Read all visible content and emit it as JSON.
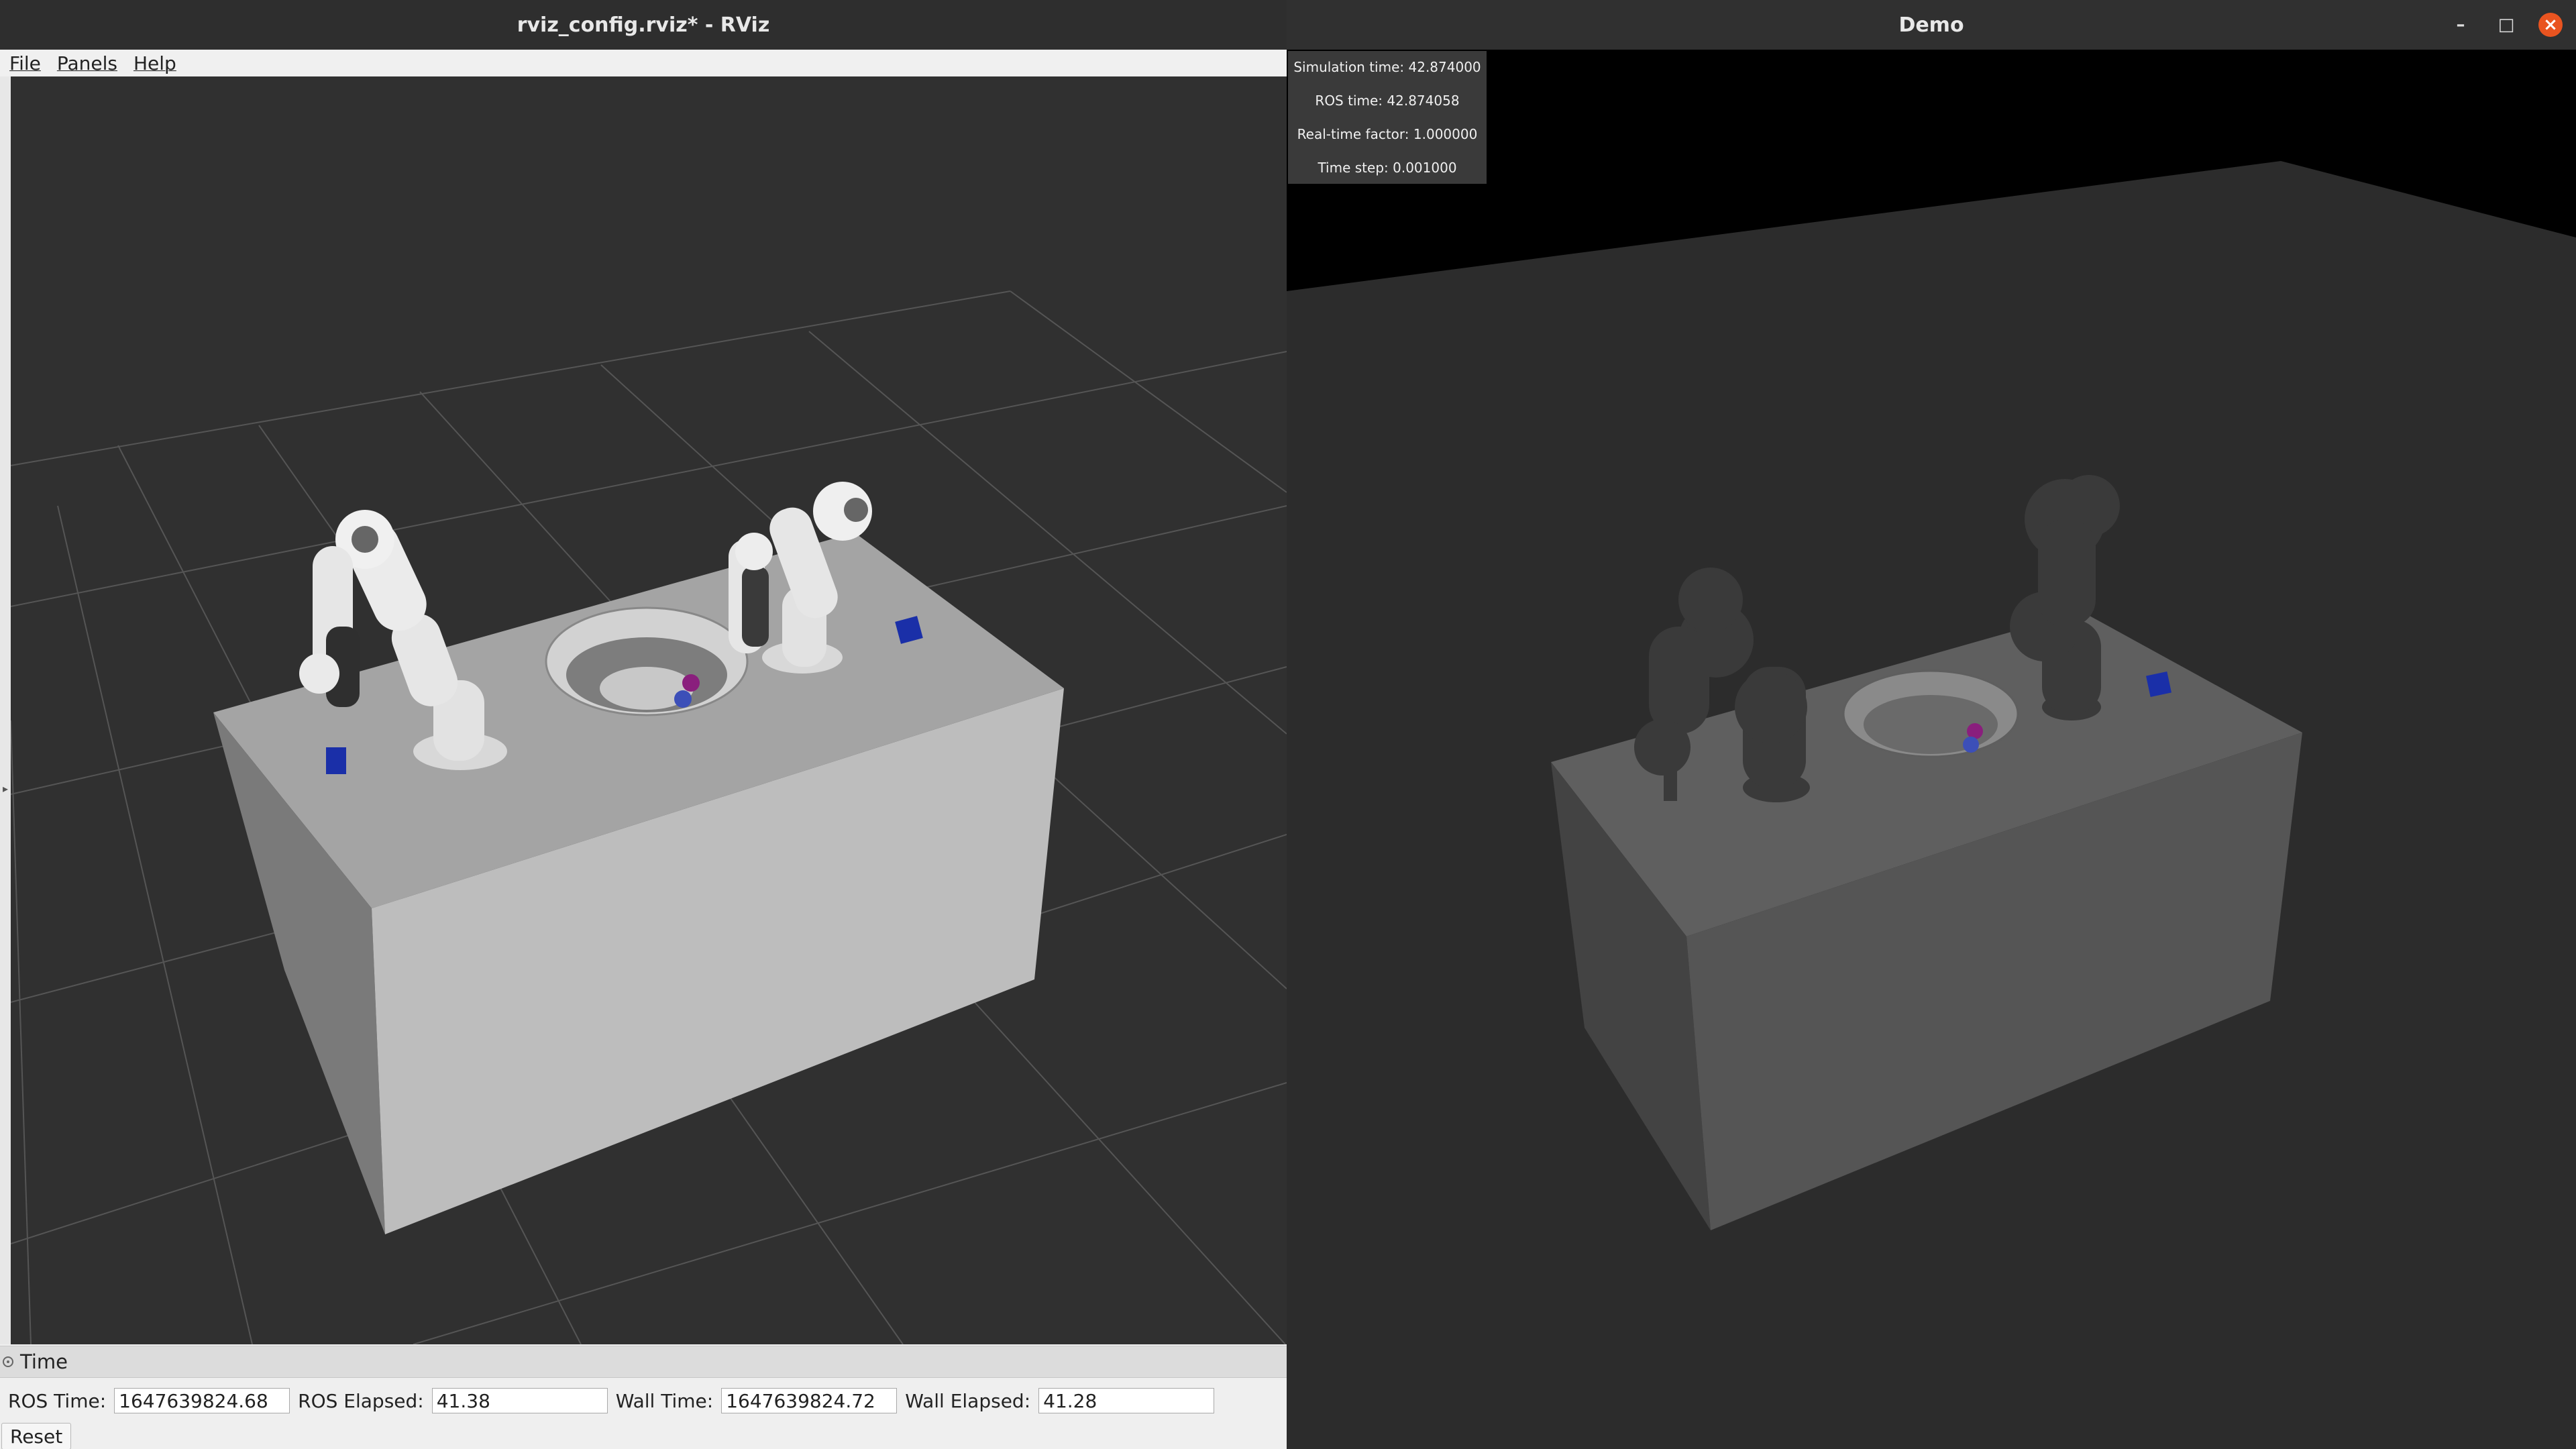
{
  "rviz": {
    "title": "rviz_config.rviz* - RViz",
    "menu": [
      "File",
      "Panels",
      "Help"
    ],
    "time_panel": {
      "title": "Time",
      "ros_time_label": "ROS Time:",
      "ros_time_value": "1647639824.68",
      "ros_elapsed_label": "ROS Elapsed:",
      "ros_elapsed_value": "41.38",
      "wall_time_label": "Wall Time:",
      "wall_time_value": "1647639824.72",
      "wall_elapsed_label": "Wall Elapsed:",
      "wall_elapsed_value": "41.28",
      "reset_label": "Reset"
    }
  },
  "demo": {
    "title": "Demo",
    "stats": {
      "simulation_time": "Simulation time: 42.874000",
      "ros_time": "ROS time: 42.874058",
      "real_time_factor": "Real-time factor: 1.000000",
      "time_step": "Time step: 0.001000"
    }
  },
  "colors": {
    "titlebar": "#2e2e2e",
    "viewport_bg": "#303030",
    "demo_bg": "#2c2c2c",
    "close_button": "#e95420",
    "cube_blue": "#1a2fa8",
    "sphere_magenta": "#8a1f7d",
    "sphere_blue": "#3c4fb8"
  },
  "icons": [
    "minimize-icon",
    "maximize-icon",
    "close-icon",
    "collapse-icon",
    "expand-arrow-icon"
  ]
}
